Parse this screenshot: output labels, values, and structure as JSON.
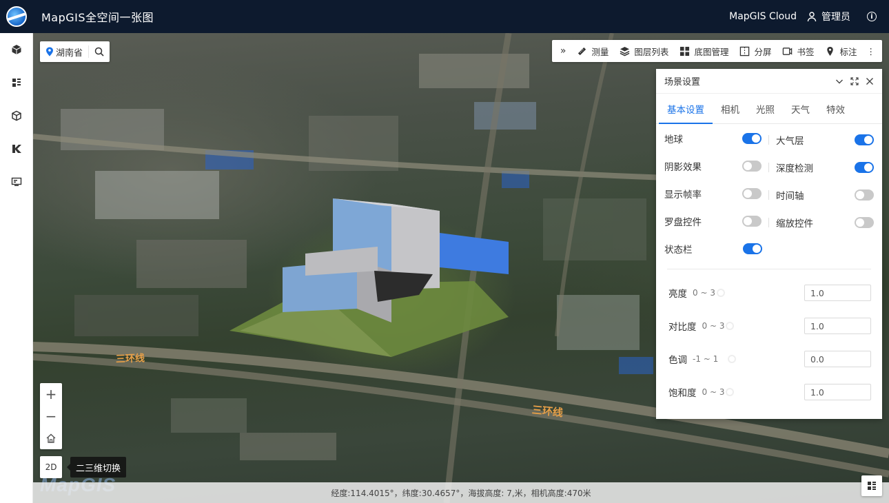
{
  "header": {
    "title": "MapGIS全空间一张图",
    "cloud_label": "MapGIS Cloud",
    "user_label": "管理员",
    "info_glyph": "i"
  },
  "sidebar": {
    "items": [
      {
        "icon": "cube-icon"
      },
      {
        "icon": "list-layers-icon"
      },
      {
        "icon": "box-3d-icon"
      },
      {
        "icon": "k-logo-icon"
      },
      {
        "icon": "monitor-icon"
      }
    ]
  },
  "search": {
    "region": "湖南省"
  },
  "toolbar": {
    "collapse": "»",
    "items": [
      {
        "label": "测量",
        "icon": "ruler-icon"
      },
      {
        "label": "图层列表",
        "icon": "layers-icon"
      },
      {
        "label": "底图管理",
        "icon": "grid-icon"
      },
      {
        "label": "分屏",
        "icon": "split-screen-icon"
      },
      {
        "label": "书签",
        "icon": "bookmark-icon"
      },
      {
        "label": "标注",
        "icon": "pin-icon"
      }
    ],
    "more": "⋮"
  },
  "panel": {
    "title": "场景设置",
    "tabs": [
      "基本设置",
      "相机",
      "光照",
      "天气",
      "特效"
    ],
    "active_tab": "基本设置",
    "toggles": [
      {
        "label": "地球",
        "on": true
      },
      {
        "label": "大气层",
        "on": true
      },
      {
        "label": "阴影效果",
        "on": false
      },
      {
        "label": "深度检测",
        "on": true
      },
      {
        "label": "显示帧率",
        "on": false
      },
      {
        "label": "时间轴",
        "on": false
      },
      {
        "label": "罗盘控件",
        "on": false
      },
      {
        "label": "缩放控件",
        "on": false
      },
      {
        "label": "状态栏",
        "on": true
      }
    ],
    "sliders": [
      {
        "label": "亮度",
        "range": "0 ~ 3",
        "value": "1.0"
      },
      {
        "label": "对比度",
        "range": "0 ~ 3",
        "value": "1.0"
      },
      {
        "label": "色调",
        "range": "-1 ~ 1",
        "value": "0.0"
      },
      {
        "label": "饱和度",
        "range": "0 ~ 3",
        "value": "1.0"
      }
    ]
  },
  "map_controls": {
    "zoom_in": "+",
    "zoom_out": "−",
    "mode_2d": "2D",
    "tooltip": "二三维切换",
    "watermark": "MapGIS"
  },
  "map_labels": {
    "ring_road_1": "三环线",
    "ring_road_2": "三环线"
  },
  "statusbar": {
    "text": "经度:114.4015°，纬度:30.4657°，海拔高度: 7,米，相机高度:470米"
  },
  "colors": {
    "accent": "#1a73e8",
    "header_bg": "#0d1a2e"
  }
}
